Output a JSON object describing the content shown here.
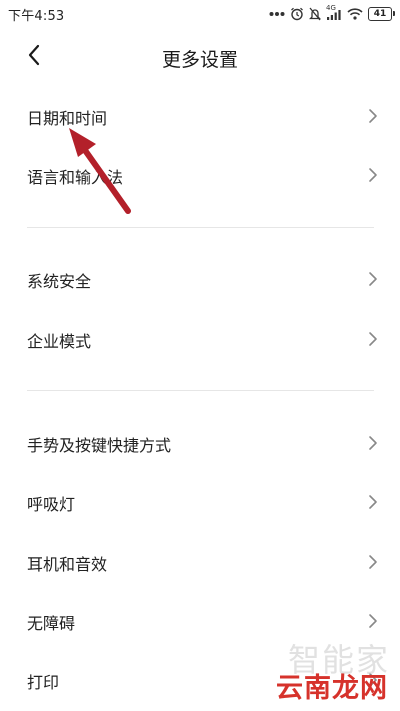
{
  "status_bar": {
    "time": "下午4:53",
    "signal_label": "4G",
    "battery": "41",
    "icons": [
      "more-dots-icon",
      "alarm-icon",
      "mute-icon",
      "signal-icon",
      "wifi-icon",
      "battery-icon"
    ]
  },
  "header": {
    "title": "更多设置",
    "back_icon": "back-arrow-icon"
  },
  "items": [
    {
      "label": "日期和时间"
    },
    {
      "label": "语言和输入法"
    },
    {
      "label": "系统安全"
    },
    {
      "label": "企业模式"
    },
    {
      "label": "手势及按键快捷方式"
    },
    {
      "label": "呼吸灯"
    },
    {
      "label": "耳机和音效"
    },
    {
      "label": "无障碍"
    },
    {
      "label": "打印"
    }
  ],
  "watermark": {
    "top": "智能家",
    "bottom": "云南龙网"
  },
  "colors": {
    "annotation_arrow": "#b3202a",
    "watermark_red": "#d6322b",
    "divider": "#e6e6e6"
  }
}
